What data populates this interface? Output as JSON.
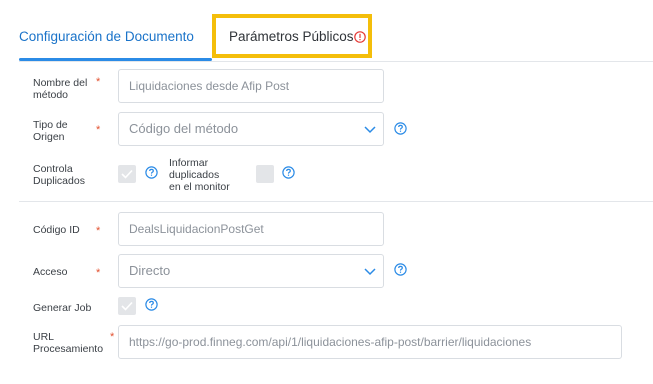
{
  "tabs": {
    "config_label": "Configuración de Documento",
    "public_params_label": "Parámetros Públicos"
  },
  "form": {
    "nombre_metodo": {
      "label_line1": "Nombre del",
      "label_line2": "método",
      "value": "Liquidaciones desde Afip Post"
    },
    "tipo_origen": {
      "label_line1": "Tipo de",
      "label_line2": "Origen",
      "value": "Código del método"
    },
    "controla_duplicados": {
      "label_line1": "Controla",
      "label_line2": "Duplicados"
    },
    "informar_duplicados": {
      "label_line1": "Informar",
      "label_line2": "duplicados",
      "label_line3": "en el monitor"
    },
    "codigo_id": {
      "label": "Código ID",
      "value": "DealsLiquidacionPostGet"
    },
    "acceso": {
      "label": "Acceso",
      "value": "Directo"
    },
    "generar_job": {
      "label": "Generar Job"
    },
    "url_procesamiento": {
      "label_line1": "URL",
      "label_line2": "Procesamiento",
      "value": "https://go-prod.finneg.com/api/1/liquidaciones-afip-post/barrier/liquidaciones"
    }
  },
  "required_marker": "*",
  "colors": {
    "accent": "#2b8be6",
    "highlight_border": "#f4be0a",
    "required": "#e2502f",
    "warning_icon": "#e53935"
  },
  "icons": {
    "warning": "exclamation-circle-icon",
    "help": "question-circle-icon",
    "chevron": "chevron-down-icon",
    "check": "checkmark-icon"
  }
}
